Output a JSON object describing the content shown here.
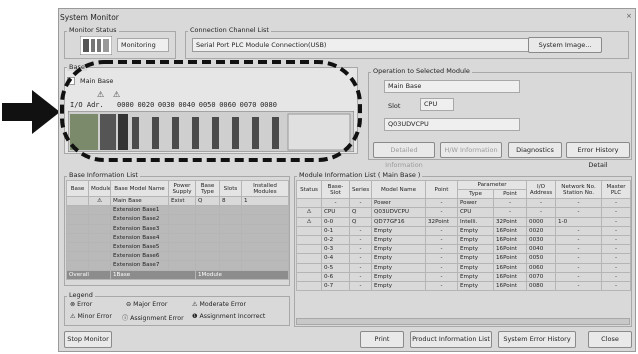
{
  "window": {
    "title": "System Monitor",
    "close": "×"
  },
  "monitor_status": {
    "label": "Monitor Status",
    "state": "Monitoring"
  },
  "connection": {
    "label": "Connection Channel List",
    "value": "Serial Port  PLC Module Connection(USB)",
    "system_image_button": "System Image..."
  },
  "base_panel": {
    "label": "Base",
    "main_base": "Main Base",
    "io_label": "I/O Adr.",
    "io_addresses": [
      "0000",
      "0020",
      "0030",
      "0040",
      "0050",
      "0060",
      "0070",
      "0080"
    ]
  },
  "selected_module": {
    "label": "Operation to Selected Module",
    "base": "Main Base",
    "slot_label": "Slot",
    "slot_value": "CPU",
    "model": "Q03UDVCPU",
    "buttons": {
      "detailed_information": "Detailed Information",
      "hw_information": "H/W Information",
      "diagnostics": "Diagnostics",
      "error_history": "Error History Detail"
    }
  },
  "base_info": {
    "label": "Base Information List",
    "headers": [
      "Base",
      "Module",
      "Base Model Name",
      "Power Supply",
      "Base Type",
      "Slots",
      "Installed Modules"
    ],
    "rows": [
      [
        "",
        "⚠",
        "Main Base",
        "Exist",
        "Q",
        "8",
        "1"
      ],
      [
        "",
        "",
        "Extension Base1",
        "",
        "",
        "",
        ""
      ],
      [
        "",
        "",
        "Extension Base2",
        "",
        "",
        "",
        ""
      ],
      [
        "",
        "",
        "Extension Base3",
        "",
        "",
        "",
        ""
      ],
      [
        "",
        "",
        "Extension Base4",
        "",
        "",
        "",
        ""
      ],
      [
        "",
        "",
        "Extension Base5",
        "",
        "",
        "",
        ""
      ],
      [
        "",
        "",
        "Extension Base6",
        "",
        "",
        "",
        ""
      ],
      [
        "",
        "",
        "Extension Base7",
        "",
        "",
        "",
        ""
      ]
    ],
    "overall": [
      "Overall",
      "",
      "1Base",
      "",
      "1Module",
      "",
      ""
    ]
  },
  "legend": {
    "label": "Legend",
    "error": "Error",
    "major_error": "Major Error",
    "moderate_error": "Moderate Error",
    "minor_error": "Minor Error",
    "assignment_error": "Assignment Error",
    "assignment_incorrect": "Assignment Incorrect"
  },
  "module_info": {
    "label": "Module Information List ( Main Base )",
    "headers": [
      "Status",
      "Base-Slot",
      "Series",
      "Model Name",
      "Point",
      "Parameter",
      "I/O Address",
      "Network No. Station No.",
      "Master PLC"
    ],
    "subheaders": [
      "Type",
      "Point"
    ],
    "rows": [
      [
        "",
        "-",
        "-",
        "Power",
        "-",
        "Power",
        "-",
        "-",
        "-",
        "-"
      ],
      [
        "⚠",
        "CPU",
        "Q",
        "Q03UDVCPU",
        "-",
        "CPU",
        "-",
        "-",
        "-",
        "-"
      ],
      [
        "⚠",
        "0-0",
        "Q",
        "QD77GF16",
        "32Point",
        "Intelli.",
        "32Point",
        "0000",
        "1-0",
        "-"
      ],
      [
        "",
        "0-1",
        "-",
        "Empty",
        "-",
        "Empty",
        "16Point",
        "0020",
        "-",
        "-"
      ],
      [
        "",
        "0-2",
        "-",
        "Empty",
        "-",
        "Empty",
        "16Point",
        "0030",
        "-",
        "-"
      ],
      [
        "",
        "0-3",
        "-",
        "Empty",
        "-",
        "Empty",
        "16Point",
        "0040",
        "-",
        "-"
      ],
      [
        "",
        "0-4",
        "-",
        "Empty",
        "-",
        "Empty",
        "16Point",
        "0050",
        "-",
        "-"
      ],
      [
        "",
        "0-5",
        "-",
        "Empty",
        "-",
        "Empty",
        "16Point",
        "0060",
        "-",
        "-"
      ],
      [
        "",
        "0-6",
        "-",
        "Empty",
        "-",
        "Empty",
        "16Point",
        "0070",
        "-",
        "-"
      ],
      [
        "",
        "0-7",
        "-",
        "Empty",
        "-",
        "Empty",
        "16Point",
        "0080",
        "-",
        "-"
      ]
    ]
  },
  "footer": {
    "stop_monitor": "Stop Monitor",
    "print": "Print",
    "product_info": "Product Information List",
    "system_error_history": "System Error History",
    "close": "Close"
  }
}
